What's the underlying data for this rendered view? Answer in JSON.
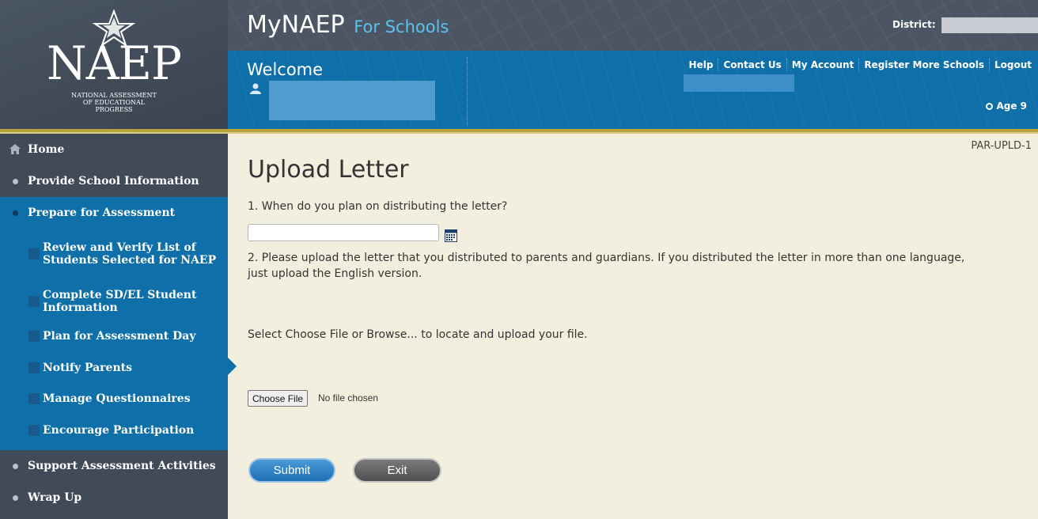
{
  "logo": {
    "name": "NAEP",
    "sub_line1": "NATIONAL ASSESSMENT",
    "sub_line2": "OF EDUCATIONAL",
    "sub_line3": "PROGRESS"
  },
  "header": {
    "app_title": "MyNAEP",
    "app_subtitle": "For Schools",
    "district_label": "District:",
    "welcome": "Welcome",
    "links": [
      "Help",
      "Contact Us",
      "My Account",
      "Register More Schools",
      "Logout"
    ],
    "age": "Age 9"
  },
  "sidebar": {
    "home": "Home",
    "provide_school_info": "Provide School Information",
    "prepare": "Prepare for Assessment",
    "sub_items": [
      "Review and Verify List of Students Selected for NAEP",
      "Complete SD/EL Student Information",
      "Plan for Assessment Day",
      "Notify Parents",
      "Manage Questionnaires",
      "Encourage Participation"
    ],
    "support": "Support Assessment Activities",
    "wrap_up": "Wrap Up"
  },
  "main": {
    "screen_id": "PAR-UPLD-1",
    "title": "Upload Letter",
    "q1": "1. When do you plan on distributing the letter?",
    "date_value": "",
    "q2": "2. Please upload the letter that you distributed to parents and guardians. If you distributed the letter in more than one language, just upload the English version.",
    "instruction": "Select Choose File or Browse... to locate and upload your file.",
    "choose_file": "Choose File",
    "file_status": "No file chosen",
    "submit": "Submit",
    "exit": "Exit"
  },
  "colors": {
    "nav_blue": "#0f6fa8",
    "sidebar_gray": "#414b57",
    "content_bg": "#f3efde",
    "accent_gold": "#b9a238",
    "brand_light_blue": "#5cc2f0"
  },
  "icons": [
    "star-icon",
    "user-icon",
    "home-icon",
    "calendar-icon",
    "radio-icon"
  ]
}
